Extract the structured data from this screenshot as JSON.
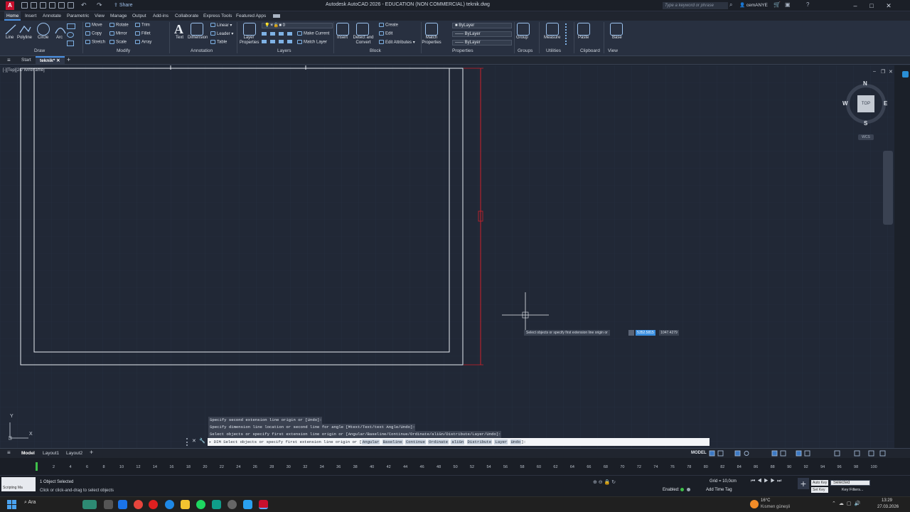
{
  "window": {
    "title": "Autodesk AutoCAD 2026 - EDUCATION (NON COMMERCIAL)    teknik.dwg",
    "app_logo": "A",
    "share_label": "Share",
    "search_placeholder": "Type a keyword or phrase",
    "user": "cemANYE"
  },
  "ribbon_tabs": [
    "Home",
    "Insert",
    "Annotate",
    "Parametric",
    "View",
    "Manage",
    "Output",
    "Add-ins",
    "Collaborate",
    "Express Tools",
    "Featured Apps"
  ],
  "ribbon": {
    "draw": {
      "title": "Draw",
      "tools": [
        "Line",
        "Polyline",
        "Circle",
        "Arc"
      ]
    },
    "modify": {
      "title": "Modify",
      "tools": [
        "Move",
        "Rotate",
        "Trim",
        "Copy",
        "Mirror",
        "Fillet",
        "Stretch",
        "Scale",
        "Array"
      ]
    },
    "annotation": {
      "title": "Annotation",
      "tools": [
        "Text",
        "Dimension",
        "Linear",
        "Leader",
        "Table"
      ]
    },
    "layers": {
      "title": "Layers",
      "layer_properties": "Layer Properties",
      "current_layer": "0",
      "make_current": "Make Current",
      "match_layer": "Match Layer"
    },
    "block": {
      "title": "Block",
      "insert": "Insert",
      "detect": "Detect and Convert",
      "create": "Create",
      "edit": "Edit",
      "edit_attributes": "Edit Attributes"
    },
    "properties": {
      "title": "Properties",
      "match": "Match Properties",
      "color": "ByLayer",
      "linetype": "ByLayer",
      "lineweight": "ByLayer"
    },
    "groups": {
      "title": "Groups",
      "group": "Group"
    },
    "utilities": {
      "title": "Utilities",
      "measure": "Measure"
    },
    "clipboard": {
      "title": "Clipboard",
      "paste": "Paste"
    },
    "view": {
      "title": "View",
      "base": "Base"
    }
  },
  "doc_tabs": {
    "start": "Start",
    "file": "teknik*"
  },
  "viewport": {
    "label": "[-][Top][2D Wireframe]"
  },
  "viewcube": {
    "top": "TOP",
    "n": "N",
    "s": "S",
    "e": "E",
    "w": "W",
    "wcs": "WCS"
  },
  "ucs": {
    "x": "X",
    "y": "Y"
  },
  "command_history": [
    "Specify second extension line origin or [Undo]:",
    "Specify dimension line location or second line for angle [Mtext/Text/text Angle/Undo]:",
    "Select objects or specify first extension line origin or [Angular/Baseline/Continue/Ordinate/aliGn/Distribute/Layer/Undo]:"
  ],
  "command_input": {
    "cmd": "DIM",
    "prompt": "Select objects or specify first extension line origin or [",
    "options": [
      "Angular",
      "Baseline",
      "Continue",
      "Ordinate",
      "aliGn",
      "Distribute",
      "Layer",
      "Undo"
    ],
    "suffix": "]:"
  },
  "cursor_tooltip": {
    "prompt": "Select objects or specify first extension line origin or",
    "x_value": "5352.5815",
    "y_value": "1047.4279"
  },
  "layout_tabs": [
    "Model",
    "Layout1",
    "Layout2"
  ],
  "status_model": "MODEL",
  "timeline_ticks": [
    "2",
    "4",
    "6",
    "8",
    "10",
    "12",
    "14",
    "16",
    "18",
    "20",
    "22",
    "24",
    "26",
    "28",
    "30",
    "32",
    "34",
    "36",
    "38",
    "40",
    "42",
    "44",
    "46",
    "48",
    "50",
    "52",
    "54",
    "56",
    "58",
    "60",
    "62",
    "64",
    "66",
    "68",
    "70",
    "72",
    "74",
    "76",
    "78",
    "80",
    "82",
    "84",
    "86",
    "88",
    "90",
    "92",
    "94",
    "96",
    "98",
    "100"
  ],
  "status": {
    "scripting": "Scripting Ma",
    "selection": "1 Object Selected",
    "hint": "Click or click-and-drag to select objects",
    "grid": "Grid = 10,0cm",
    "enabled": "Enabled:",
    "add_time_tag": "Add Time Tag",
    "auto_key": "Auto Key",
    "selected": "Selected",
    "set_key": "Set Key",
    "key_filters": "Key Filters..."
  },
  "taskbar": {
    "search": "Ara",
    "weather_temp": "16°C",
    "weather_desc": "Kısmen güneşli",
    "time": "13:29",
    "date": "27.03.2026"
  },
  "colors": {
    "accent": "#4a90e2",
    "canvas": "#212836",
    "drawing_lines": "#e8ecf2",
    "dim_lines": "#d0202a",
    "logo": "#c8102e"
  }
}
